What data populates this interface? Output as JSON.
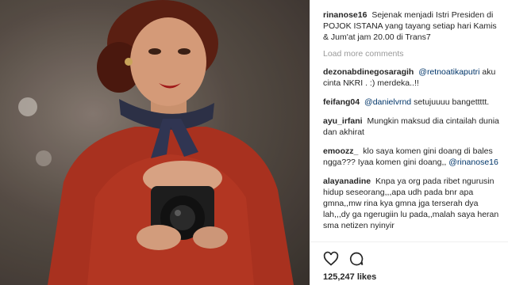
{
  "photo": {
    "alt": ""
  },
  "caption": {
    "user": "rinanose16",
    "text": "Sejenak menjadi Istri Presiden di POJOK ISTANA yang tayang setiap hari Kamis & Jum'at jam 20.00 di Trans7"
  },
  "load_more": "Load more comments",
  "comments": [
    {
      "user": "dezonabdinegosaragih",
      "mention": "@retnoatikaputri",
      "text": "aku cinta NKRI . :) merdeka..!!"
    },
    {
      "user": "feifang04",
      "mention": "@danielvrnd",
      "text": "setujuuuu bangettttt."
    },
    {
      "user": "ayu_irfani",
      "mention": "",
      "text": "Mungkin maksud dia cintailah dunia dan akhirat"
    },
    {
      "user": "emoozz_",
      "mention": "",
      "text": "klo saya komen gini doang di bales ngga??? Iyaa komen gini doang,,",
      "trailing_mention": "@rinanose16"
    },
    {
      "user": "alayanadine",
      "mention": "",
      "text": "Knpa ya org pada ribet ngurusin hidup seseorang,,,apa udh pada bnr apa gmna,,mw rina kya gmna jga terserah dya lah,,,dy ga ngerugiin lu pada,,malah saya heran sma netizen nyinyir"
    }
  ],
  "actions": {
    "like_icon": "heart-outline",
    "comment_icon": "speech-bubble-outline",
    "likes": "125,247 likes"
  },
  "colors": {
    "username": "#262626",
    "mention": "#003569",
    "muted": "#999999",
    "border": "#efefef"
  }
}
